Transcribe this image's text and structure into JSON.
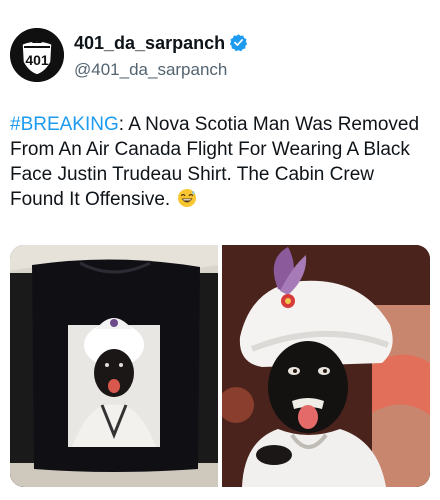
{
  "author": {
    "display_name": "401_da_sarpanch",
    "handle": "@401_da_sarpanch",
    "verified": true,
    "avatar_text": "401",
    "avatar_icon": "highway-shield-icon",
    "verified_icon": "verified-badge-icon"
  },
  "tweet": {
    "hashtag": "#BREAKING",
    "body": ": A Nova Scotia Man Was Removed From An Air Canada Flight For Wearing A Black Face Justin Trudeau Shirt. The Cabin Crew Found It Offensive.",
    "emoji": "laughing-with-sweat-emoji"
  },
  "media": [
    {
      "icon": "tshirt-photo"
    },
    {
      "icon": "costume-photo"
    }
  ],
  "colors": {
    "text": "#0f1419",
    "secondary": "#536471",
    "link": "#1d9bf0",
    "verified": "#1d9bf0"
  }
}
